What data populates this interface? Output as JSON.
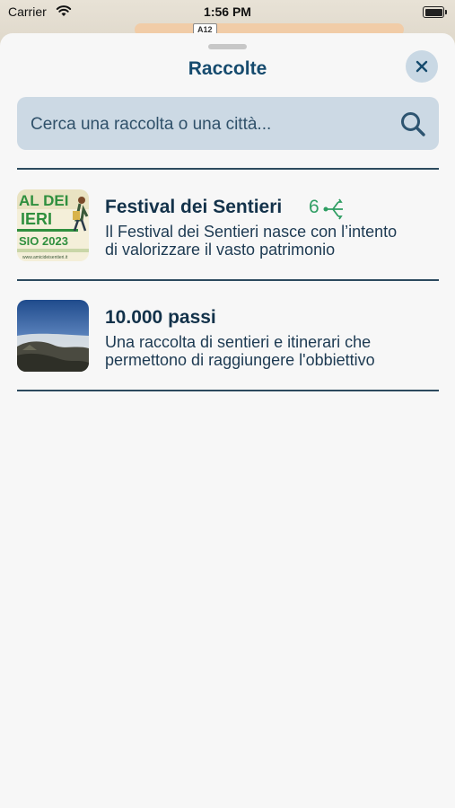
{
  "status_bar": {
    "carrier": "Carrier",
    "time": "1:56 PM"
  },
  "map": {
    "road_badge": "A12"
  },
  "sheet": {
    "title": "Raccolte",
    "search": {
      "placeholder": "Cerca una raccolta o una città..."
    }
  },
  "collections": [
    {
      "title": "Festival dei Sentieri",
      "count": "6",
      "count_icon": "branch-network-icon",
      "description_line1": "Il Festival dei Sentieri nasce con l’intento",
      "description_line2": "di valorizzare il vasto patrimonio",
      "thumbnail": {
        "line1": "AL DEI",
        "line2": "IERI",
        "line3": "SIO 2023",
        "line4": "www.amicideisentieri.it"
      }
    },
    {
      "title": "10.000 passi",
      "description_line1": "Una raccolta di sentieri e itinerari che",
      "description_line2": "permettono di raggiungere l'obbiettivo"
    }
  ],
  "colors": {
    "accent": "#164b6e",
    "count_green": "#2f9e63",
    "search_bg": "#ccd9e4",
    "close_bg": "#c9d8e4"
  }
}
